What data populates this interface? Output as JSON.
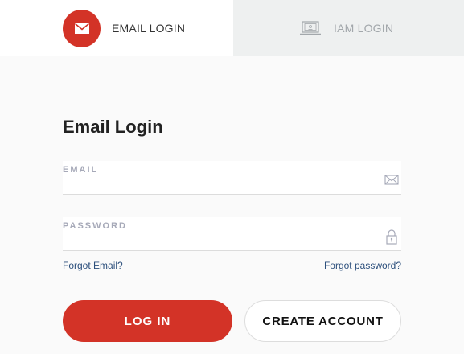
{
  "tabs": {
    "email": {
      "label": "EMAIL LOGIN",
      "icon": "envelope-icon",
      "active": true
    },
    "iam": {
      "label": "IAM LOGIN",
      "icon": "laptop-icon",
      "active": false
    }
  },
  "form": {
    "title": "Email Login",
    "email": {
      "placeholder": "EMAIL",
      "value": "",
      "icon": "envelope-outline-icon"
    },
    "password": {
      "placeholder": "PASSWORD",
      "value": "",
      "icon": "lock-icon"
    },
    "forgot_email": "Forgot Email?",
    "forgot_password": "Forgot password?",
    "login_button": "LOG IN",
    "create_button": "CREATE ACCOUNT"
  },
  "colors": {
    "accent": "#d33327",
    "link": "#2c4f7c",
    "inactive_tab_bg": "#eef0f0"
  }
}
